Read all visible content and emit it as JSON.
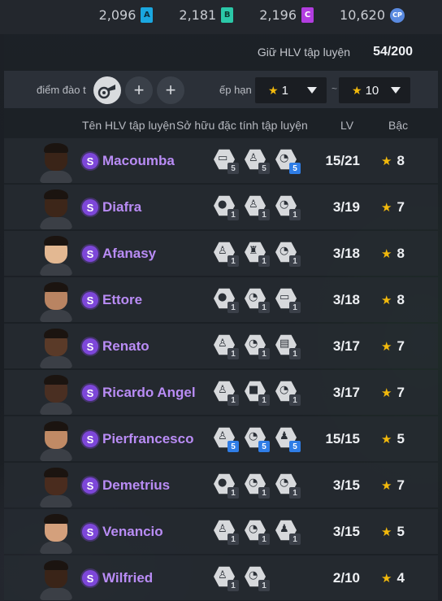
{
  "currencies": [
    {
      "value": "2,096",
      "badge": "A"
    },
    {
      "value": "2,181",
      "badge": "B"
    },
    {
      "value": "2,196",
      "badge": "C"
    },
    {
      "value": "10,620",
      "badge": "CP"
    }
  ],
  "hold": {
    "label": "Giữ HLV tập luyện",
    "value": "54/200"
  },
  "filter": {
    "trait_label": "điểm đào t",
    "rank_label": "ếp hạn",
    "plus": "+",
    "rank_from": "1",
    "rank_to": "10",
    "tilde": "~"
  },
  "columns": {
    "name": "Tên HLV tập luyện",
    "traits": "Sở hữu đặc tính tập luyện",
    "lv": "LV",
    "grade": "Bậc"
  },
  "colors": {
    "accent_purple": "#b98cf5",
    "star": "#f2b90c",
    "blue_level": "#2f7de6"
  },
  "rows": [
    {
      "name": "Macoumba",
      "lv": "15/21",
      "grade": "8",
      "skin": "#3a2418",
      "traits": [
        {
          "icon": "board-icon",
          "level": "5",
          "blue": false
        },
        {
          "icon": "player-icon",
          "level": "5",
          "blue": false
        },
        {
          "icon": "whistle-icon",
          "level": "5",
          "blue": true
        }
      ]
    },
    {
      "name": "Diafra",
      "lv": "3/19",
      "grade": "7",
      "skin": "#3d2619",
      "traits": [
        {
          "icon": "ball-icon",
          "level": "1",
          "blue": false
        },
        {
          "icon": "player-icon",
          "level": "1",
          "blue": false
        },
        {
          "icon": "whistle-icon",
          "level": "1",
          "blue": false
        }
      ]
    },
    {
      "name": "Afanasy",
      "lv": "3/18",
      "grade": "8",
      "skin": "#e3b892",
      "traits": [
        {
          "icon": "player-icon",
          "level": "1",
          "blue": false
        },
        {
          "icon": "trophy-icon",
          "level": "1",
          "blue": false
        },
        {
          "icon": "whistle-icon",
          "level": "1",
          "blue": false
        }
      ]
    },
    {
      "name": "Ettore",
      "lv": "3/18",
      "grade": "8",
      "skin": "#b98462",
      "traits": [
        {
          "icon": "ball-icon",
          "level": "1",
          "blue": false
        },
        {
          "icon": "whistle-icon",
          "level": "1",
          "blue": false
        },
        {
          "icon": "board-icon",
          "level": "1",
          "blue": false
        }
      ]
    },
    {
      "name": "Renato",
      "lv": "3/17",
      "grade": "7",
      "skin": "#5a3a28",
      "traits": [
        {
          "icon": "player-icon",
          "level": "1",
          "blue": false
        },
        {
          "icon": "whistle-icon",
          "level": "1",
          "blue": false
        },
        {
          "icon": "chart-icon",
          "level": "1",
          "blue": false
        }
      ]
    },
    {
      "name": "Ricardo Angel",
      "lv": "3/17",
      "grade": "7",
      "skin": "#4a2f22",
      "traits": [
        {
          "icon": "player-icon",
          "level": "1",
          "blue": false
        },
        {
          "icon": "lock-icon",
          "level": "1",
          "blue": false
        },
        {
          "icon": "whistle-icon",
          "level": "1",
          "blue": false
        }
      ]
    },
    {
      "name": "Pierfrancesco",
      "lv": "15/15",
      "grade": "5",
      "skin": "#c08a65",
      "traits": [
        {
          "icon": "player-icon",
          "level": "5",
          "blue": true
        },
        {
          "icon": "whistle-icon",
          "level": "5",
          "blue": true
        },
        {
          "icon": "stretch-icon",
          "level": "5",
          "blue": true
        }
      ]
    },
    {
      "name": "Demetrius",
      "lv": "3/15",
      "grade": "7",
      "skin": "#4a2c1e",
      "traits": [
        {
          "icon": "ball-icon",
          "level": "1",
          "blue": false
        },
        {
          "icon": "whistle-icon",
          "level": "1",
          "blue": false
        },
        {
          "icon": "whistle-icon",
          "level": "1",
          "blue": false
        }
      ]
    },
    {
      "name": "Venancio",
      "lv": "3/15",
      "grade": "5",
      "skin": "#d4a07c",
      "traits": [
        {
          "icon": "player-icon",
          "level": "1",
          "blue": false
        },
        {
          "icon": "whistle-icon",
          "level": "1",
          "blue": false
        },
        {
          "icon": "stretch-icon",
          "level": "1",
          "blue": false
        }
      ]
    },
    {
      "name": "Wilfried",
      "lv": "2/10",
      "grade": "4",
      "skin": "#3a2418",
      "traits": [
        {
          "icon": "player-icon",
          "level": "1",
          "blue": false
        },
        {
          "icon": "whistle-icon",
          "level": "1",
          "blue": false
        }
      ]
    }
  ]
}
